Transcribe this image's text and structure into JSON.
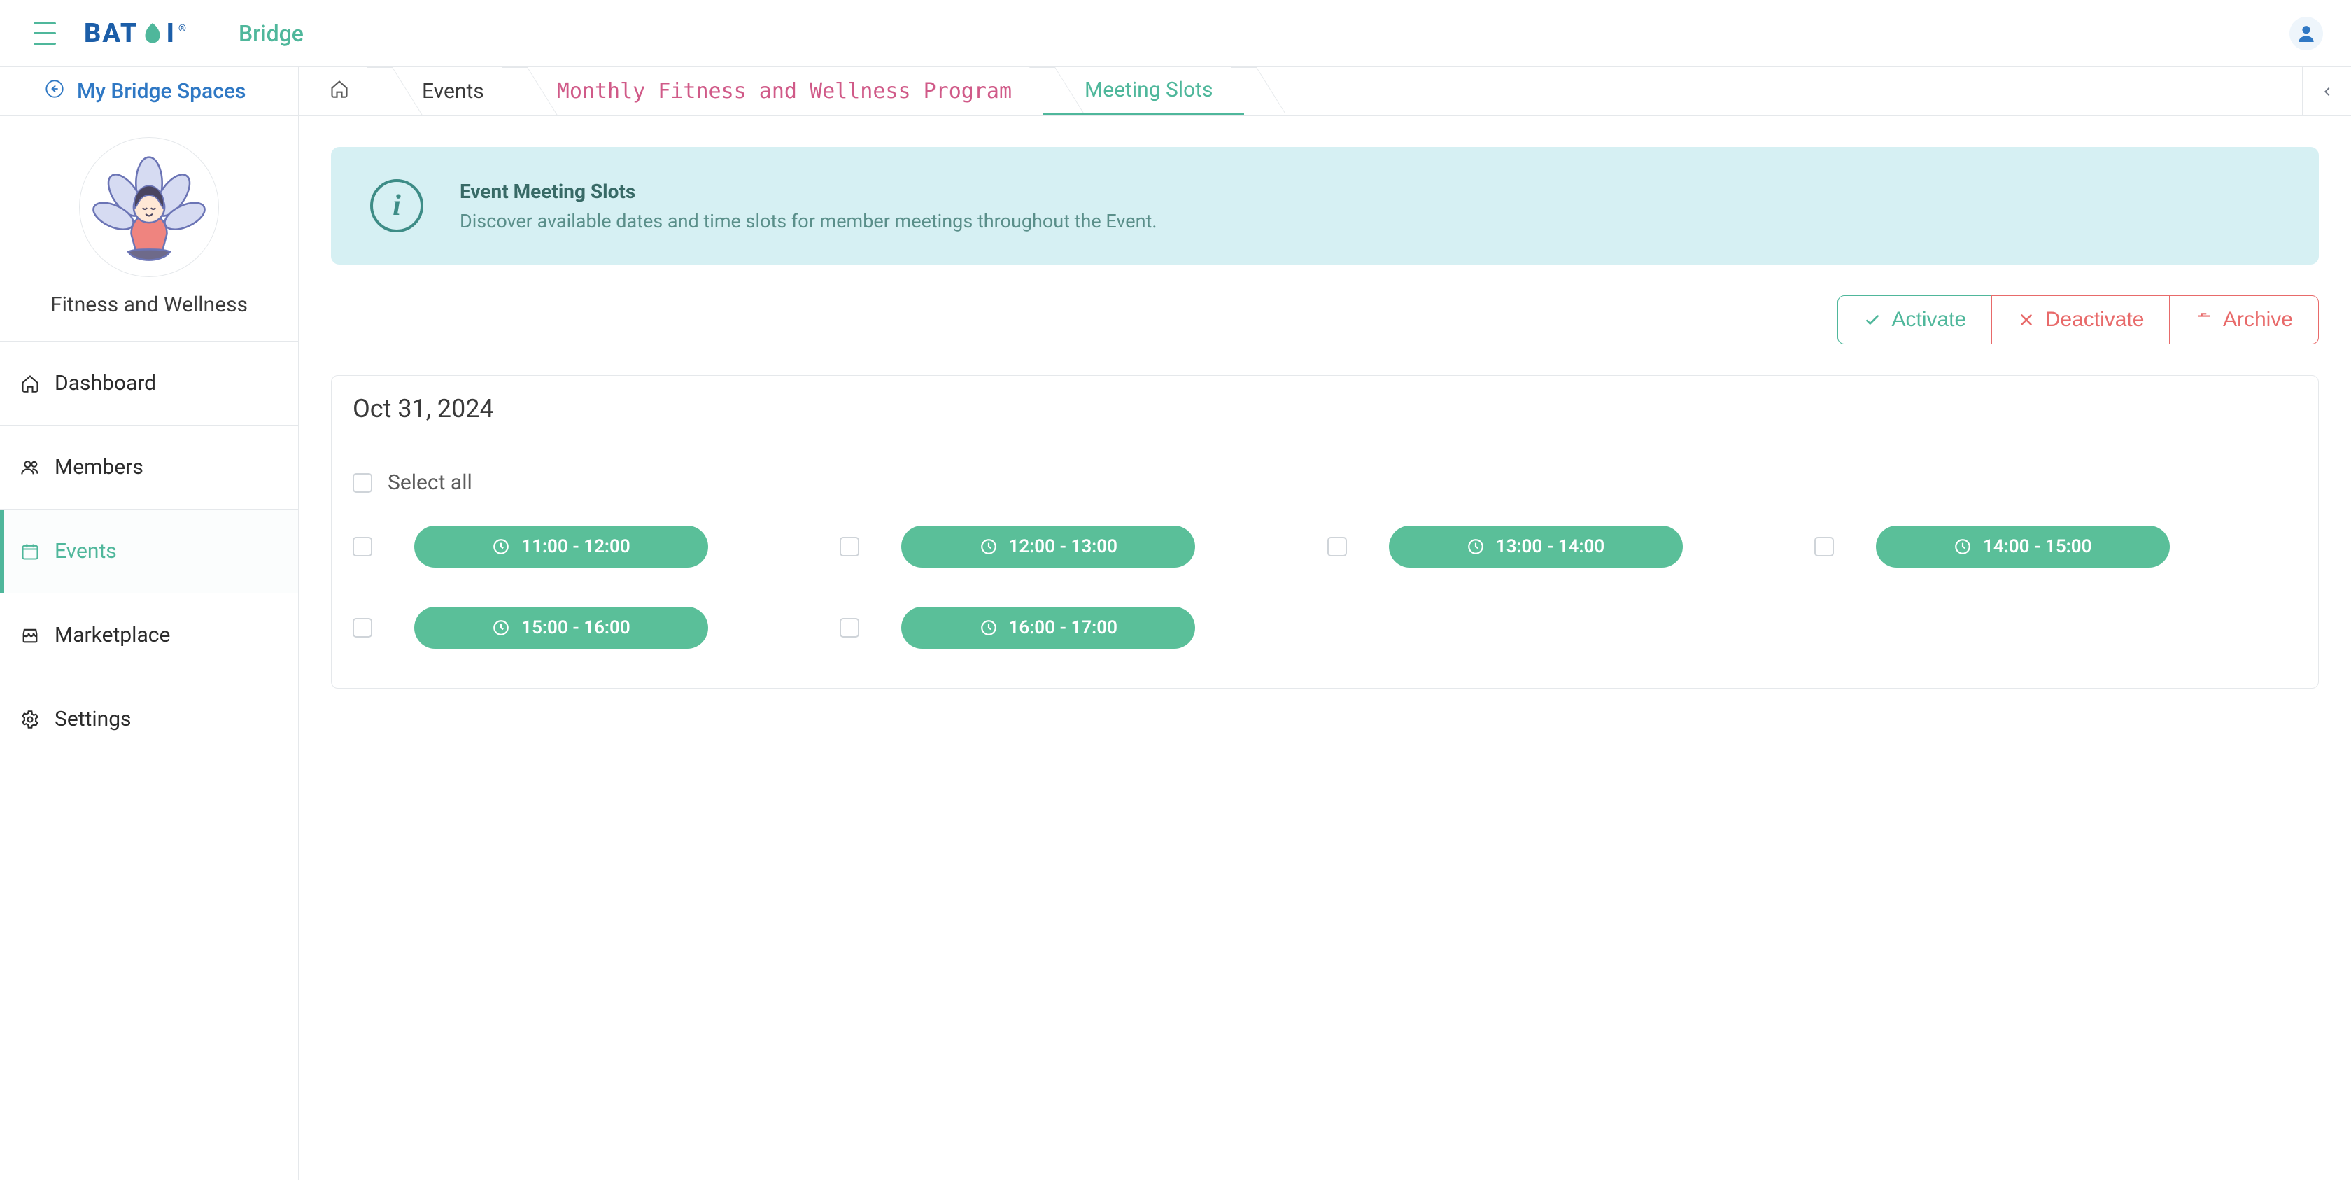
{
  "header": {
    "logo_part1": "BAT",
    "logo_part2": "I",
    "app_name": "Bridge"
  },
  "sidebar": {
    "back_link": "My Bridge Spaces",
    "space_name": "Fitness and Wellness",
    "items": [
      {
        "label": "Dashboard",
        "active": false
      },
      {
        "label": "Members",
        "active": false
      },
      {
        "label": "Events",
        "active": true
      },
      {
        "label": "Marketplace",
        "active": false
      },
      {
        "label": "Settings",
        "active": false
      }
    ]
  },
  "breadcrumb": {
    "items": [
      {
        "label": "Events"
      },
      {
        "label": "Monthly Fitness and Wellness Program"
      },
      {
        "label": "Meeting Slots"
      }
    ]
  },
  "banner": {
    "title": "Event Meeting Slots",
    "desc": "Discover available dates and time slots for member meetings throughout the Event."
  },
  "actions": {
    "activate": "Activate",
    "deactivate": "Deactivate",
    "archive": "Archive"
  },
  "card": {
    "date": "Oct 31, 2024",
    "select_all": "Select all",
    "slots": [
      {
        "label": "11:00 - 12:00"
      },
      {
        "label": "12:00 - 13:00"
      },
      {
        "label": "13:00 - 14:00"
      },
      {
        "label": "14:00 - 15:00"
      },
      {
        "label": "15:00 - 16:00"
      },
      {
        "label": "16:00 - 17:00"
      }
    ]
  }
}
